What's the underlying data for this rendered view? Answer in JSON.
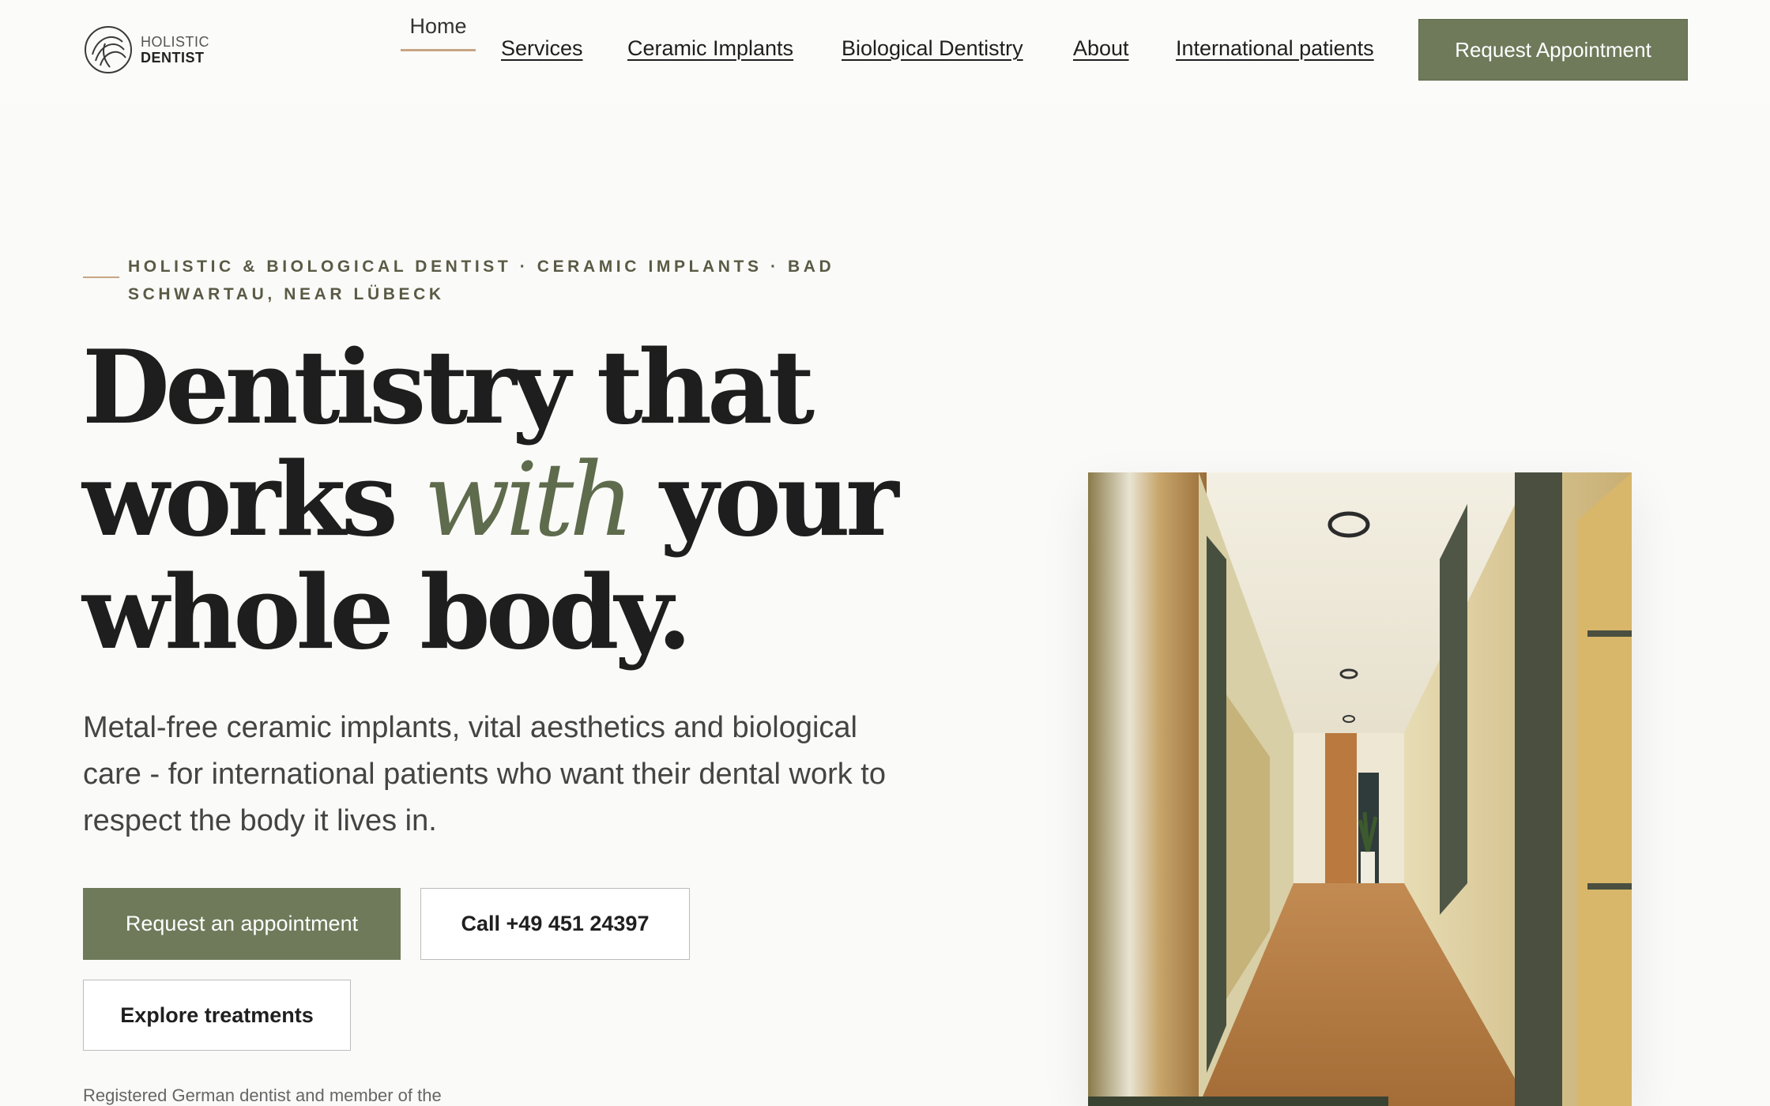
{
  "header": {
    "logo": {
      "line1": "HOLISTIC",
      "line2": "DENTIST",
      "icon": "logo-mark-icon"
    },
    "nav": {
      "home": "Home",
      "items": [
        {
          "label": "Services"
        },
        {
          "label": "Ceramic Implants"
        },
        {
          "label": "Biological Dentistry"
        },
        {
          "label": "About"
        },
        {
          "label": "International patients"
        }
      ],
      "cta": "Request Appointment"
    }
  },
  "hero": {
    "eyebrow": "HOLISTIC & BIOLOGICAL DENTIST · CERAMIC IMPLANTS · BAD SCHWARTAU, NEAR LÜBECK",
    "headline": {
      "line1": "Dentistry that",
      "line2_before": "works ",
      "line2_accent": "with",
      "line2_after": " your",
      "line3": "whole body."
    },
    "lede": "Metal-free ceramic implants, vital aesthetics and biological care - for international patients who want their dental work to respect the body it lives in.",
    "buttons": {
      "primary": "Request an appointment",
      "call": "Call +49 451 24397",
      "explore": "Explore treatments"
    },
    "footnote": "Registered German dentist and member of the"
  },
  "colors": {
    "accent_green": "#6e7a5a",
    "accent_italic": "#5e6b4c",
    "rule_tan": "#c7a584",
    "background": "#fafaf8"
  }
}
